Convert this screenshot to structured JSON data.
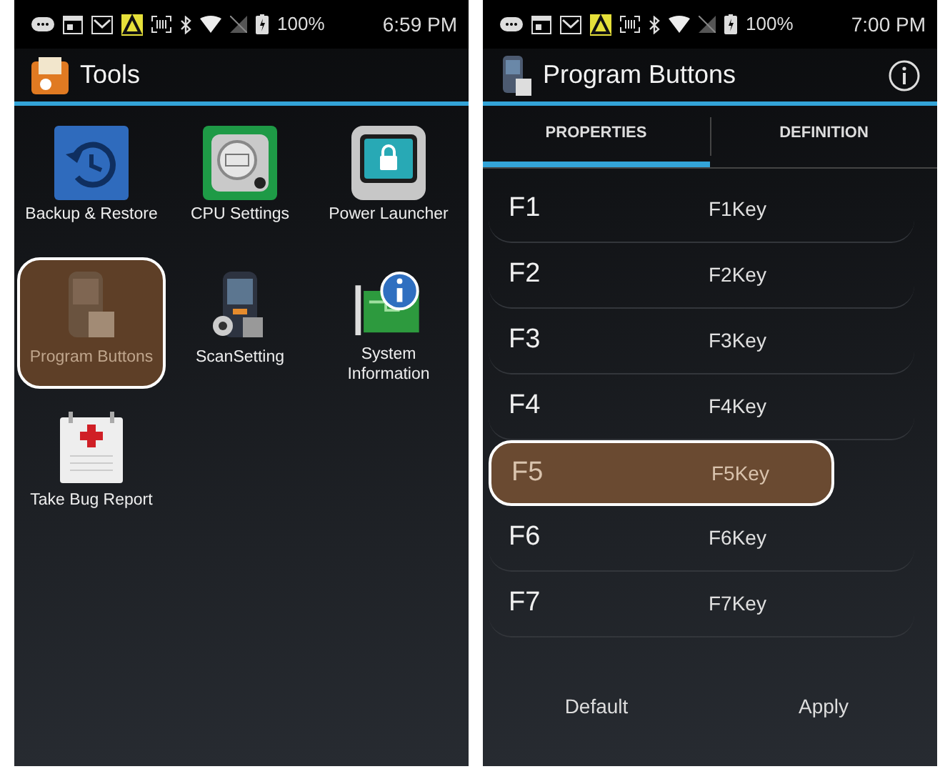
{
  "tools_screen": {
    "status_bar": {
      "battery": "100%",
      "time": "6:59 PM"
    },
    "title": "Tools",
    "apps": [
      {
        "label": "Backup & Restore",
        "selected": false
      },
      {
        "label": "CPU Settings",
        "selected": false
      },
      {
        "label": "Power Launcher",
        "selected": false
      },
      {
        "label": "Program Buttons",
        "selected": true
      },
      {
        "label": "ScanSetting",
        "selected": false
      },
      {
        "label": "System\nInformation",
        "selected": false
      },
      {
        "label": "Take Bug Report",
        "selected": false
      }
    ]
  },
  "program_buttons_screen": {
    "status_bar": {
      "battery": "100%",
      "time": "7:00 PM"
    },
    "title": "Program Buttons",
    "tabs": [
      {
        "label": "PROPERTIES",
        "selected": true
      },
      {
        "label": "DEFINITION",
        "selected": false
      }
    ],
    "rows": [
      {
        "key": "F1",
        "value": "F1Key",
        "selected": false
      },
      {
        "key": "F2",
        "value": "F2Key",
        "selected": false
      },
      {
        "key": "F3",
        "value": "F3Key",
        "selected": false
      },
      {
        "key": "F4",
        "value": "F4Key",
        "selected": false
      },
      {
        "key": "F5",
        "value": "F5Key",
        "selected": true
      },
      {
        "key": "F6",
        "value": "F6Key",
        "selected": false
      },
      {
        "key": "F7",
        "value": "F7Key",
        "selected": false
      }
    ],
    "buttons": [
      "Default",
      "Apply"
    ]
  }
}
